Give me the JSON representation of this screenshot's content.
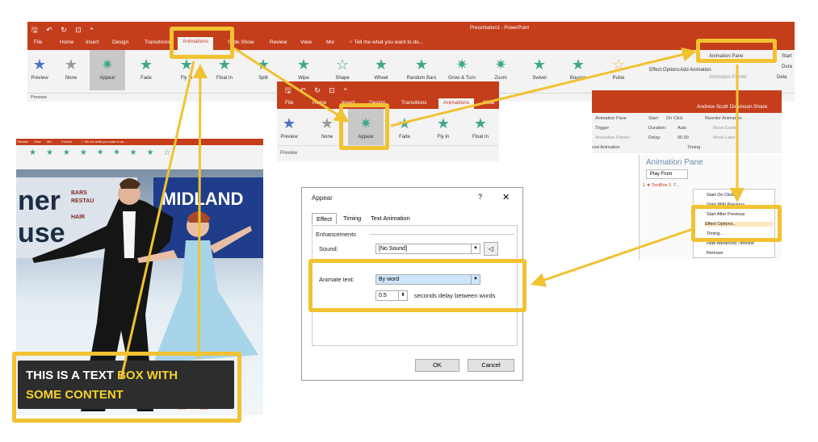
{
  "main_window": {
    "title": "Presentation1 - PowerPoint",
    "qat": "🖫 ↶ ↻ ⊡ ⁼",
    "tabs": [
      "File",
      "Home",
      "Insert",
      "Design",
      "Transitions",
      "Animations",
      "Slide Show",
      "Review",
      "View",
      "Mix",
      "♀ Tell me what you want to do..."
    ],
    "preview_label": "Preview",
    "preview_group": "Preview",
    "animations": [
      "None",
      "Appear",
      "Fade",
      "Fly In",
      "Float In",
      "Split",
      "Wipe",
      "Shape",
      "Wheel",
      "Random Bars",
      "Grow & Turn",
      "Zoom",
      "Swivel",
      "Bounce",
      "Pulse"
    ],
    "effect_options": "Effect Options",
    "add_animation": "Add Animation",
    "animation_pane": "Animation Pane",
    "animation_painter": "Animation Painter",
    "start": "Start",
    "duration": "Dura",
    "delay": "Dela"
  },
  "second_window": {
    "qat": "🖫 ↶ ↻ ⊡ ⁼",
    "tabs": [
      "File",
      "Home",
      "Insert",
      "Design",
      "Transitions",
      "Animations",
      "Slide"
    ],
    "animations": [
      "None",
      "Appear",
      "Fade",
      "Fly In",
      "Float In"
    ],
    "preview_label": "Preview",
    "preview_group": "Preview"
  },
  "third_window": {
    "user": "Andrew Scott Dickinson",
    "share": "Share",
    "animation_pane_btn": "Animation Pane",
    "trigger": "Trigger",
    "animation_painter": "Animation Painter",
    "advanced_animation": "ced Animation",
    "start_label": "Start:",
    "start_value": "On Click",
    "duration_label": "Duration:",
    "duration_value": "Auto",
    "delay_label": "Delay:",
    "delay_value": "00.00",
    "reorder": "Reorder Animation",
    "move_earlier": "Move Earlier",
    "move_later": "Move Later",
    "timing": "Timing",
    "pane_title": "Animation Pane",
    "play_from": "Play From",
    "item": "1 ★ TextBox 1: T...",
    "menu": [
      "Start On Click",
      "Start With Previous",
      "Start After Previous",
      "Effect Options...",
      "Timing...",
      "Hide Advanced Timeline",
      "Remove"
    ]
  },
  "slide": {
    "ribbon_tabs": [
      "Review",
      "View",
      "Mix",
      "Format",
      "♀ Tell me what you want to do..."
    ],
    "sign_left_line1": "ner",
    "sign_left_line2": "use",
    "sign_bars": "BARS",
    "sign_restau": "RESTAU",
    "sign_hair": "HAIR",
    "sign_right": "MIDLAND",
    "textbox_line1_plain": "THIS IS  A TEXT ",
    "textbox_line1_hl": "BOX WITH",
    "textbox_line2_hl": "SOME CONTENT"
  },
  "dialog": {
    "title": "Appear",
    "help": "?",
    "close": "✕",
    "tabs": [
      "Effect",
      "Timing",
      "Text Animation"
    ],
    "enhancements": "Enhancements",
    "sound_label": "Sound:",
    "sound_value": "[No Sound]",
    "animate_text_label": "Animate text:",
    "animate_text_value": "By word",
    "delay_value": "0.5",
    "delay_suffix": "seconds delay between words",
    "ok": "OK",
    "cancel": "Cancel"
  },
  "colors": {
    "accent": "#c43e1c",
    "highlight": "#f1c232",
    "star": "#3fa68d"
  }
}
